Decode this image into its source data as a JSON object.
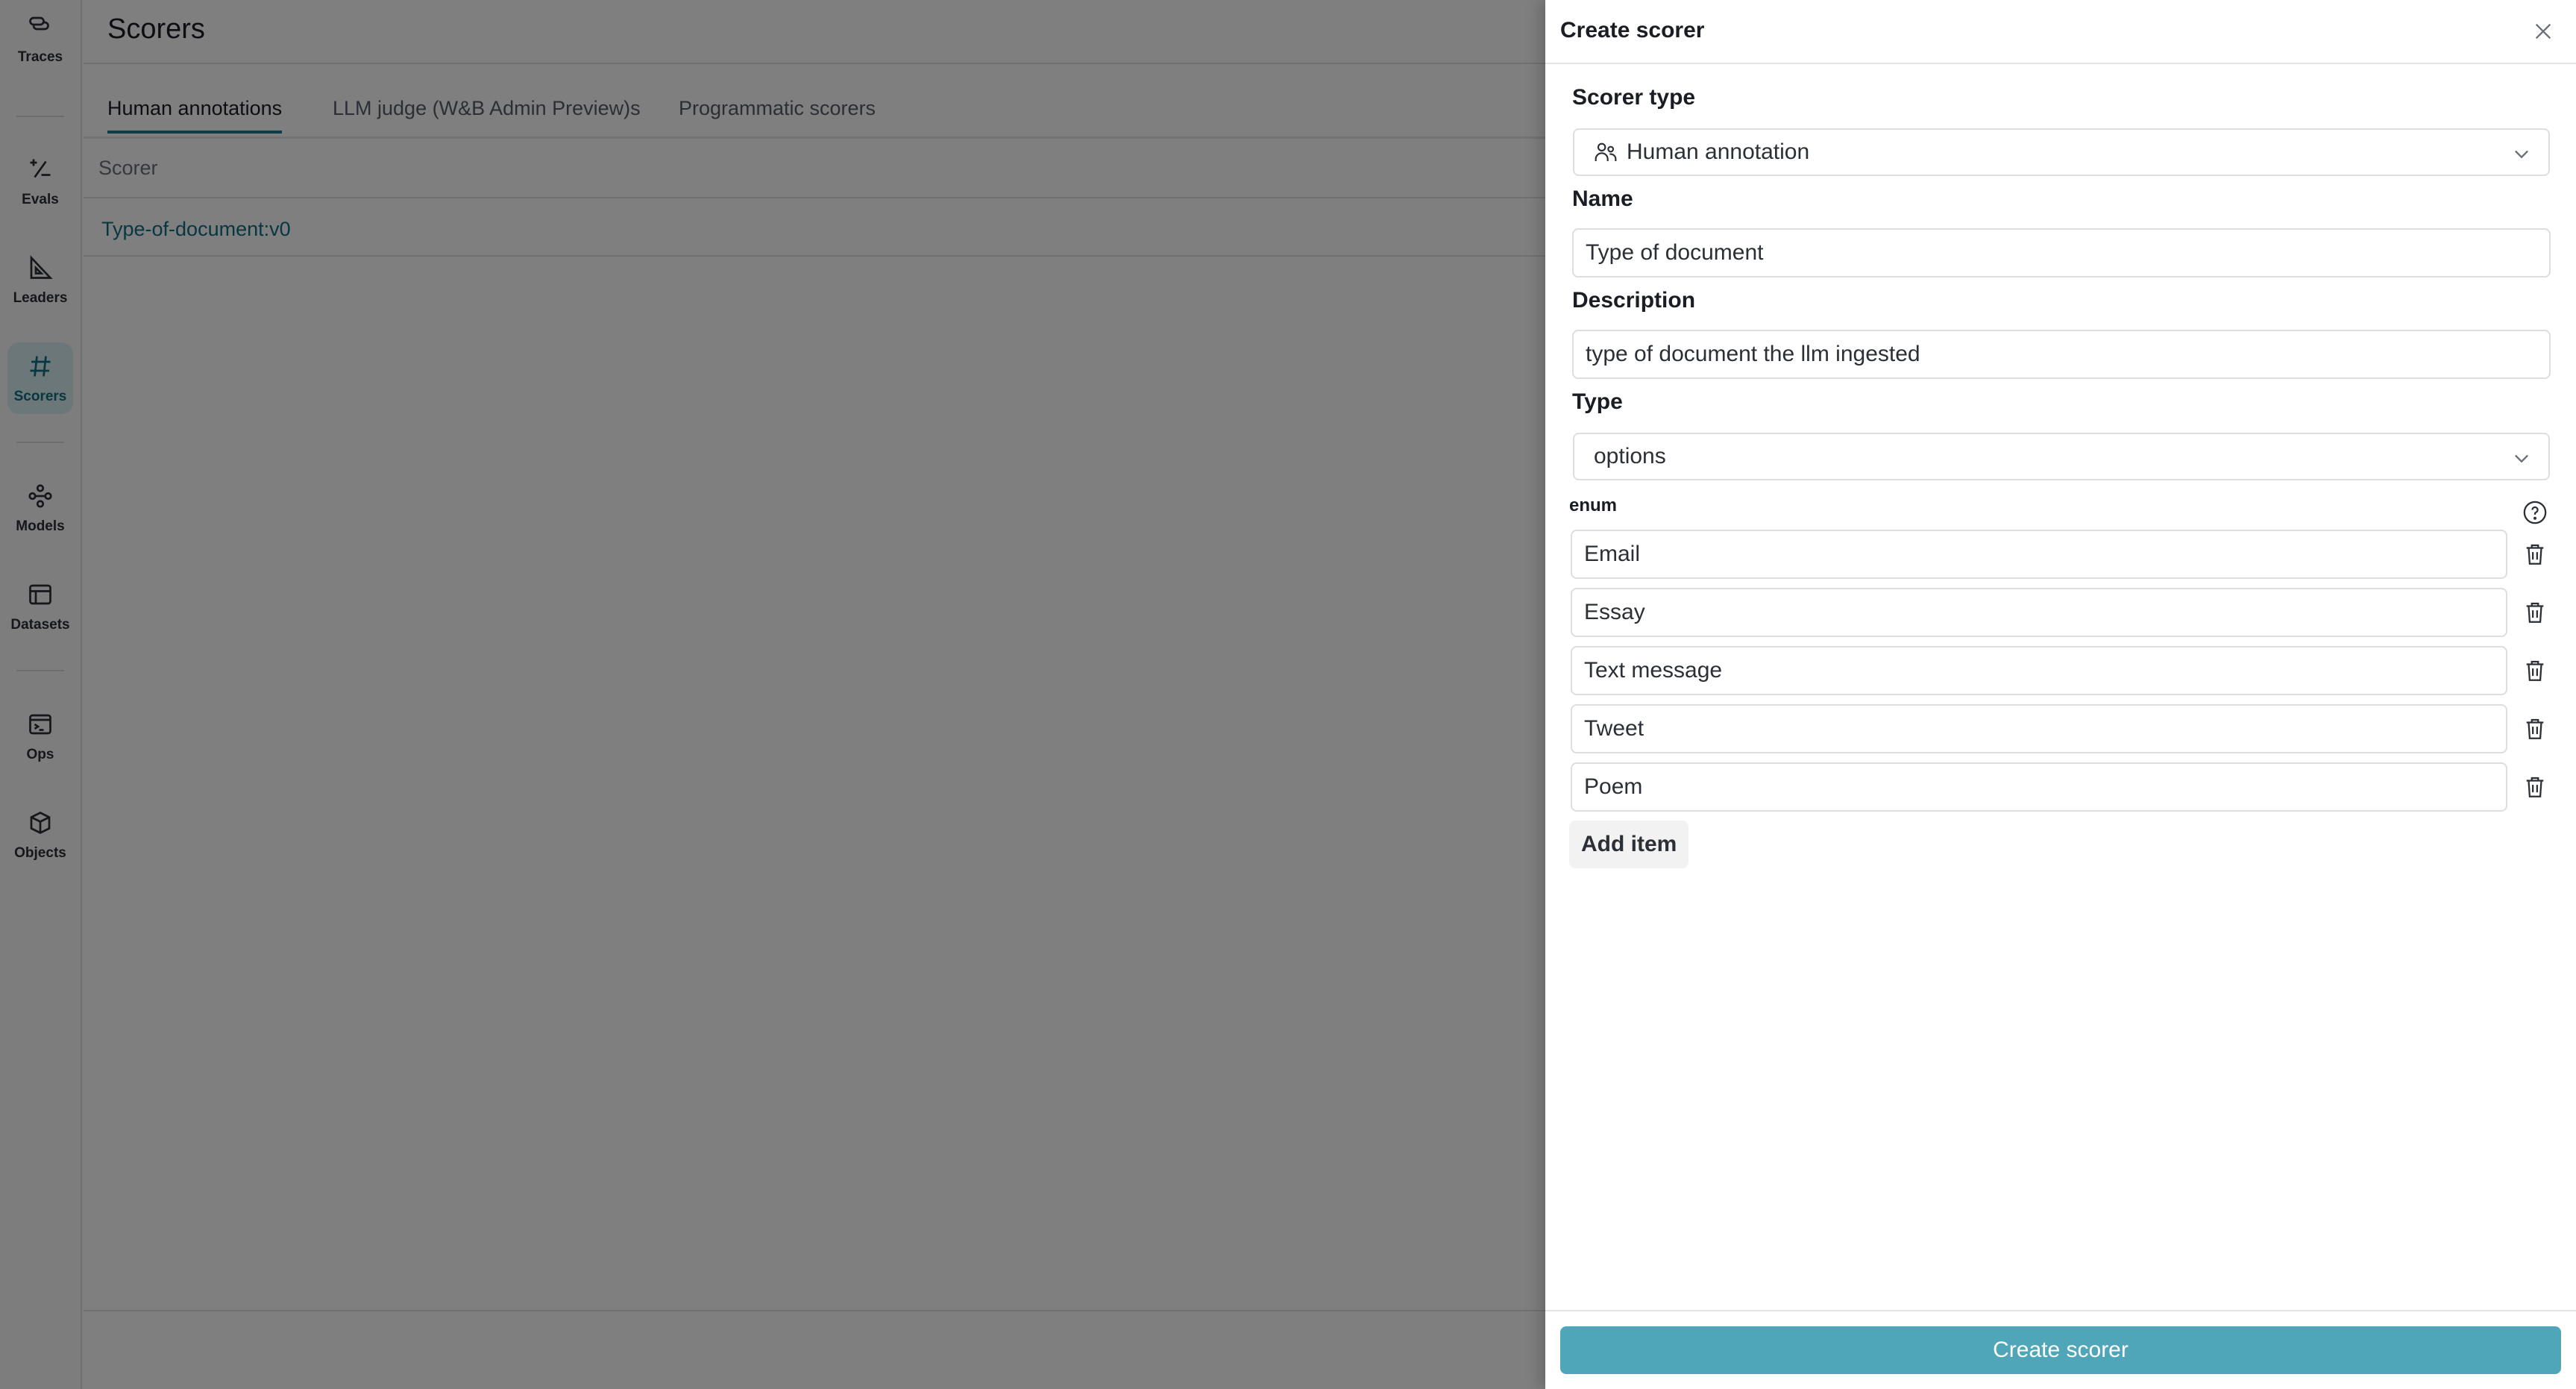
{
  "sidebar": {
    "items": [
      {
        "label": "Traces",
        "icon": "traces-icon",
        "active": false
      },
      {
        "label": "Evals",
        "icon": "plus-minus-icon",
        "active": false
      },
      {
        "label": "Leaders",
        "icon": "set-square-icon",
        "active": false
      },
      {
        "label": "Scorers",
        "icon": "hash-icon",
        "active": true
      },
      {
        "label": "Models",
        "icon": "model-graph-icon",
        "active": false
      },
      {
        "label": "Datasets",
        "icon": "table-icon",
        "active": false
      },
      {
        "label": "Ops",
        "icon": "terminal-icon",
        "active": false
      },
      {
        "label": "Objects",
        "icon": "cube-icon",
        "active": false
      }
    ]
  },
  "main": {
    "title": "Scorers",
    "tabs": [
      {
        "label": "Human annotations",
        "active": true
      },
      {
        "label": "LLM judge (W&B Admin Preview)s",
        "active": false
      },
      {
        "label": "Programmatic scorers",
        "active": false
      }
    ],
    "table": {
      "header": "Scorer",
      "rows": [
        "Type-of-document:v0"
      ]
    }
  },
  "drawer": {
    "title": "Create scorer",
    "scorer_type_label": "Scorer type",
    "scorer_type_value": "Human annotation",
    "name_label": "Name",
    "name_value": "Type of document",
    "description_label": "Description",
    "description_value": "type of document the llm ingested",
    "type_label": "Type",
    "type_value": "options",
    "enum_label": "enum",
    "enum_items": [
      "Email",
      "Essay",
      "Text message",
      "Tweet",
      "Poem"
    ],
    "add_item_label": "Add item",
    "submit_label": "Create scorer"
  },
  "colors": {
    "accent": "#1b7a8c",
    "primary_button": "#4fa6b8",
    "link": "#0e6e82"
  }
}
